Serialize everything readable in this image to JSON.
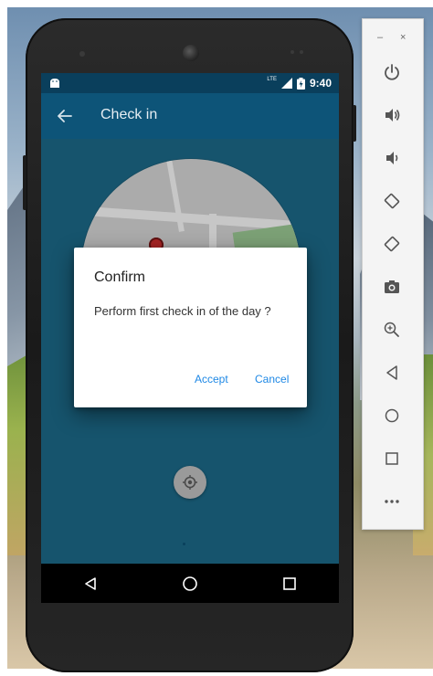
{
  "status_bar": {
    "time": "9:40",
    "network": "LTE"
  },
  "app_bar": {
    "title": "Check in"
  },
  "dialog": {
    "title": "Confirm",
    "message": "Perform first check in of the day ?",
    "accept_label": "Accept",
    "cancel_label": "Cancel"
  },
  "toolbar": {
    "minimize_label": "–",
    "close_label": "×",
    "items": [
      "power-icon",
      "volume-up-icon",
      "volume-down-icon",
      "rotate-left-icon",
      "rotate-right-icon",
      "camera-icon",
      "zoom-icon",
      "back-icon",
      "home-icon",
      "overview-icon",
      "more-icon"
    ]
  },
  "colors": {
    "app_bar": "#0d5478",
    "status_bar": "#0a3f5c",
    "content": "#1d6c8c",
    "dialog_button": "#1e88e5"
  }
}
